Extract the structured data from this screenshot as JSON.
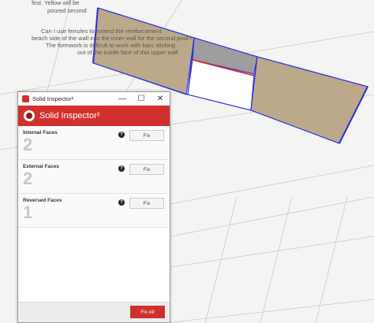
{
  "canvas": {
    "note_lines": [
      "first. Yellow will be",
      "poured second",
      "Can I use ferrules to extend the reinforcement",
      "beach side of the wall into the inner wall for the second pour?",
      "The formwork is difficult to work with bars sticking",
      "out of the inside face of this upper wall."
    ]
  },
  "inspector": {
    "window_title": "Solid Inspector²",
    "header_title": "Solid Inspector²",
    "minimize_glyph": "—",
    "maximize_glyph": "☐",
    "close_glyph": "✕",
    "sections": [
      {
        "label": "Internal Faces",
        "count": "2",
        "help": "?",
        "fix_label": "Fix"
      },
      {
        "label": "External Faces",
        "count": "2",
        "help": "?",
        "fix_label": "Fix"
      },
      {
        "label": "Reversed Faces",
        "count": "1",
        "help": "?",
        "fix_label": "Fix"
      }
    ],
    "fix_all_label": "Fix All"
  },
  "colors": {
    "wall_fill": "#bca98a",
    "selection_edge": "#2a2ae0",
    "error_edge": "#e02020",
    "accent": "#d0302f"
  }
}
